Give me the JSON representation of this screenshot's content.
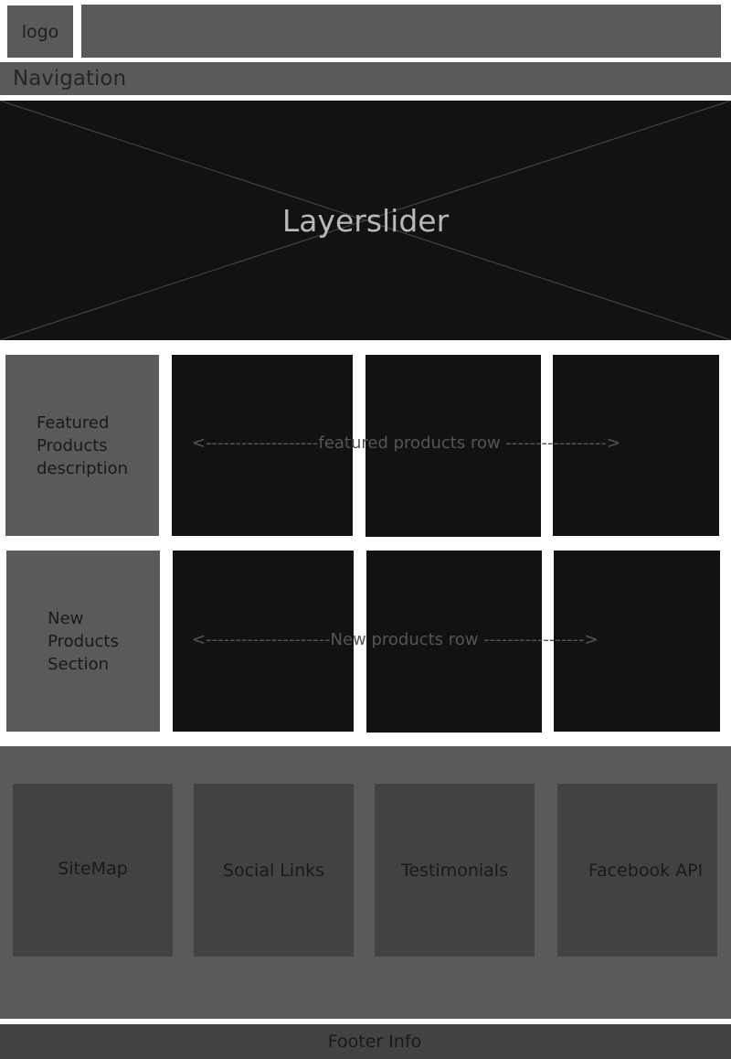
{
  "header": {
    "logo": "logo"
  },
  "navigation": {
    "label": "Navigation"
  },
  "slider": {
    "label": "Layerslider"
  },
  "featured": {
    "description_lines": [
      "Featured",
      "Products",
      "description"
    ],
    "row_label": "<-------------------featured products row ----------------->"
  },
  "new_products": {
    "description_lines": [
      "New",
      "Products",
      "Section"
    ],
    "row_label": "<---------------------New products row ----------------->"
  },
  "footer": {
    "columns": [
      "SiteMap",
      "Social Links",
      "Testimonials",
      "Facebook API"
    ],
    "info": "Footer Info"
  }
}
